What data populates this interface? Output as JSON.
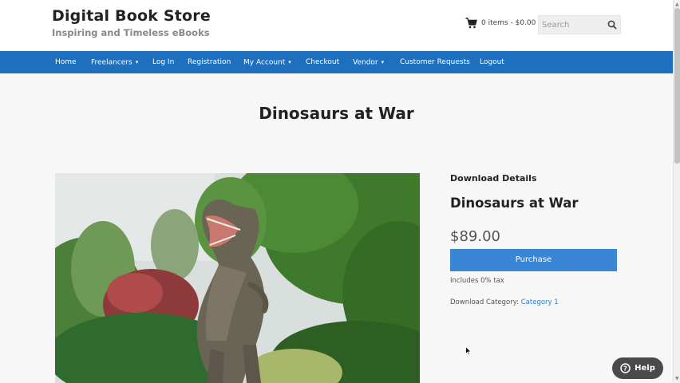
{
  "site": {
    "title": "Digital Book Store",
    "tagline": "Inspiring and Timeless eBooks"
  },
  "header": {
    "cart_label": "0 items - $0.00",
    "cart_icon": "shopping-cart-icon",
    "search_placeholder": "Search",
    "search_icon": "search-icon"
  },
  "nav": {
    "items": [
      {
        "label": "Home",
        "has_submenu": false
      },
      {
        "label": "Freelancers",
        "has_submenu": true
      },
      {
        "label": "Log In",
        "has_submenu": false
      },
      {
        "label": "Registration",
        "has_submenu": false
      },
      {
        "label": "My Account",
        "has_submenu": true
      },
      {
        "label": "Checkout",
        "has_submenu": false
      },
      {
        "label": "Vendor",
        "has_submenu": true
      },
      {
        "label": "Customer Requests",
        "has_submenu": false
      },
      {
        "label": "Logout",
        "has_submenu": false
      }
    ],
    "caret": "▾"
  },
  "page": {
    "title": "Dinosaurs at War"
  },
  "product": {
    "image_alt": "Dinosaur statue among trees",
    "details_heading": "Download Details",
    "name": "Dinosaurs at War",
    "price": "$89.00",
    "purchase_label": "Purchase",
    "tax_note": "Includes 0% tax",
    "category_prefix": "Download Category:",
    "category_link": "Category 1"
  },
  "help": {
    "label": "Help",
    "icon": "question-circle-icon"
  },
  "colors": {
    "nav_bg": "#1f6fbf",
    "button_bg": "#3a86d4",
    "link": "#2f7bc9",
    "help_bg": "#4a4a4a"
  }
}
